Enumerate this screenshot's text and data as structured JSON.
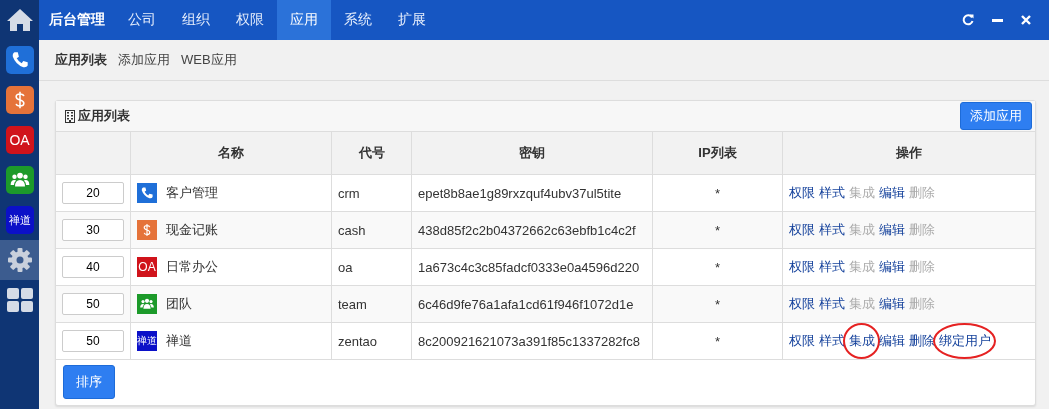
{
  "sidebar": {
    "items": [
      {
        "kind": "home",
        "selected": false
      },
      {
        "kind": "phone",
        "selected": false
      },
      {
        "kind": "dollar",
        "selected": false
      },
      {
        "kind": "oa",
        "label": "OA",
        "selected": false
      },
      {
        "kind": "team",
        "selected": false
      },
      {
        "kind": "zentao",
        "label": "禅道",
        "selected": false
      },
      {
        "kind": "gear",
        "selected": true
      },
      {
        "kind": "grid",
        "selected": false
      }
    ]
  },
  "topbar": {
    "title": "后台管理",
    "tabs": [
      {
        "label": "公司",
        "selected": false
      },
      {
        "label": "组织",
        "selected": false
      },
      {
        "label": "权限",
        "selected": false
      },
      {
        "label": "应用",
        "selected": true
      },
      {
        "label": "系统",
        "selected": false
      },
      {
        "label": "扩展",
        "selected": false
      }
    ],
    "controls": [
      {
        "kind": "refresh"
      },
      {
        "kind": "minimize"
      },
      {
        "kind": "close"
      }
    ]
  },
  "subnav": [
    {
      "label": "应用列表",
      "selected": true
    },
    {
      "label": "添加应用",
      "selected": false
    },
    {
      "label": "WEB应用",
      "selected": false
    }
  ],
  "panel": {
    "title": "应用列表",
    "add_button": "添加应用",
    "sort_button": "排序",
    "table": {
      "columns": [
        "名称",
        "代号",
        "密钥",
        "IP列表",
        "操作"
      ],
      "rows": [
        {
          "order": "20",
          "icon": {
            "kind": "phone"
          },
          "name": "客户管理",
          "code": "crm",
          "key": "epet8b8ae1g89rxzquf4ubv37ul5tite",
          "ip": "*",
          "actions": [
            {
              "label": "权限",
              "disabled": false,
              "circled": false
            },
            {
              "label": "样式",
              "disabled": false,
              "circled": false
            },
            {
              "label": "集成",
              "disabled": true,
              "circled": false
            },
            {
              "label": "编辑",
              "disabled": false,
              "circled": false
            },
            {
              "label": "删除",
              "disabled": true,
              "circled": false
            }
          ]
        },
        {
          "order": "30",
          "icon": {
            "kind": "dollar"
          },
          "name": "现金记账",
          "code": "cash",
          "key": "438d85f2c2b04372662c63ebfb1c4c2f",
          "ip": "*",
          "actions": [
            {
              "label": "权限",
              "disabled": false,
              "circled": false
            },
            {
              "label": "样式",
              "disabled": false,
              "circled": false
            },
            {
              "label": "集成",
              "disabled": true,
              "circled": false
            },
            {
              "label": "编辑",
              "disabled": false,
              "circled": false
            },
            {
              "label": "删除",
              "disabled": true,
              "circled": false
            }
          ]
        },
        {
          "order": "40",
          "icon": {
            "kind": "oa",
            "label": "OA"
          },
          "name": "日常办公",
          "code": "oa",
          "key": "1a673c4c3c85fadcf0333e0a4596d220",
          "ip": "*",
          "actions": [
            {
              "label": "权限",
              "disabled": false,
              "circled": false
            },
            {
              "label": "样式",
              "disabled": false,
              "circled": false
            },
            {
              "label": "集成",
              "disabled": true,
              "circled": false
            },
            {
              "label": "编辑",
              "disabled": false,
              "circled": false
            },
            {
              "label": "删除",
              "disabled": true,
              "circled": false
            }
          ]
        },
        {
          "order": "50",
          "icon": {
            "kind": "team"
          },
          "name": "团队",
          "code": "team",
          "key": "6c46d9fe76a1afa1cd61f946f1072d1e",
          "ip": "*",
          "actions": [
            {
              "label": "权限",
              "disabled": false,
              "circled": false
            },
            {
              "label": "样式",
              "disabled": false,
              "circled": false
            },
            {
              "label": "集成",
              "disabled": true,
              "circled": false
            },
            {
              "label": "编辑",
              "disabled": false,
              "circled": false
            },
            {
              "label": "删除",
              "disabled": true,
              "circled": false
            }
          ]
        },
        {
          "order": "50",
          "icon": {
            "kind": "zentao",
            "label": "禅道"
          },
          "name": "禅道",
          "code": "zentao",
          "key": "8c200921621073a391f85c1337282fc8",
          "ip": "*",
          "actions": [
            {
              "label": "权限",
              "disabled": false,
              "circled": false
            },
            {
              "label": "样式",
              "disabled": false,
              "circled": false
            },
            {
              "label": "集成",
              "disabled": false,
              "circled": true
            },
            {
              "label": "编辑",
              "disabled": false,
              "circled": false
            },
            {
              "label": "删除",
              "disabled": false,
              "circled": false
            },
            {
              "label": "绑定用户",
              "disabled": false,
              "circled": true
            }
          ]
        }
      ]
    }
  }
}
